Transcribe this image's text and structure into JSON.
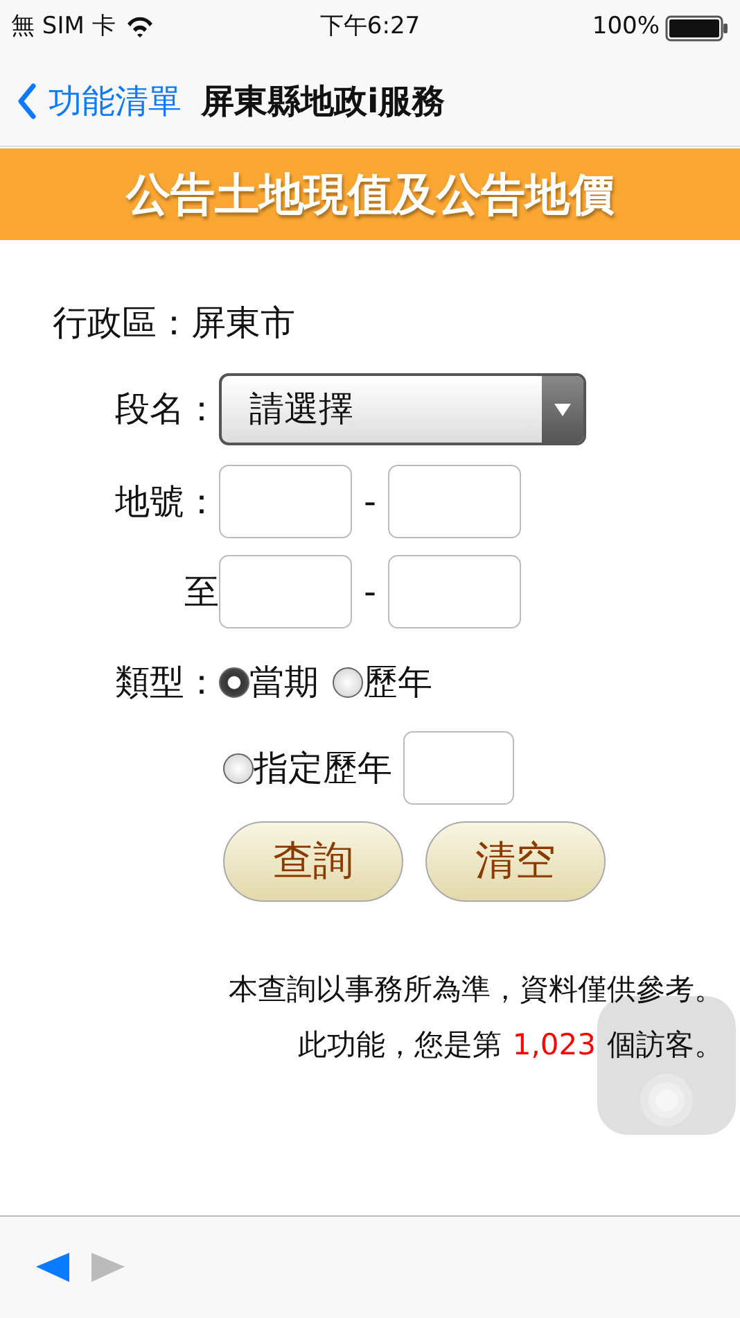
{
  "status_bar": {
    "carrier": "無 SIM 卡",
    "time": "下午6:27",
    "battery": "100%"
  },
  "nav": {
    "back": "功能清單",
    "title": "屏東縣地政i服務"
  },
  "banner": "公告土地現值及公告地價",
  "district": {
    "label": "行政區：",
    "value": "屏東市"
  },
  "section": {
    "label": "段名：",
    "value": "請選擇"
  },
  "lot_rows": [
    {
      "label": "地號：",
      "separator": "-"
    },
    {
      "label": "至",
      "separator": "-"
    }
  ],
  "type": {
    "label": "類型：",
    "options": [
      {
        "label": "當期",
        "selected": true,
        "kind": "plain"
      },
      {
        "label": "歷年",
        "selected": false,
        "kind": "plain"
      },
      {
        "label": "指定歷年",
        "selected": false,
        "kind": "year-field"
      }
    ]
  },
  "buttons": [
    "查詢",
    "清空"
  ],
  "notice": "本查詢以事務所為準，資料僅供參考。",
  "visitor": {
    "prefix": "此功能，您是第",
    "count": "1,023",
    "suffix": "個訪客。"
  },
  "toolbar": {
    "back_enabled": true,
    "forward_enabled": false
  }
}
